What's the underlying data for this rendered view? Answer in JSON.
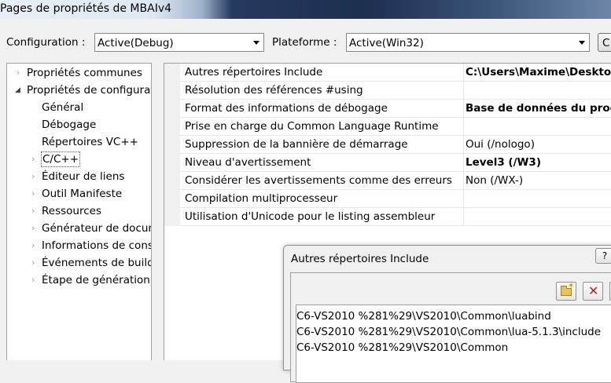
{
  "window": {
    "title": "Pages de propriétés de MBAIv4"
  },
  "config_bar": {
    "configuration_label": "Configuration :",
    "configuration_value": "Active(Debug)",
    "platform_label": "Plateforme :",
    "platform_value": "Active(Win32)",
    "button_label": "C"
  },
  "tree": {
    "items": [
      {
        "label": "Propriétés communes",
        "level": 0,
        "expander": "collapsed"
      },
      {
        "label": "Propriétés de configurat",
        "level": 0,
        "expander": "expanded"
      },
      {
        "label": "Général",
        "level": 1,
        "expander": "none"
      },
      {
        "label": "Débogage",
        "level": 1,
        "expander": "none"
      },
      {
        "label": "Répertoires VC++",
        "level": 1,
        "expander": "none"
      },
      {
        "label": "C/C++",
        "level": 1,
        "expander": "collapsed",
        "selected": true
      },
      {
        "label": "Éditeur de liens",
        "level": 1,
        "expander": "collapsed"
      },
      {
        "label": "Outil Manifeste",
        "level": 1,
        "expander": "collapsed"
      },
      {
        "label": "Ressources",
        "level": 1,
        "expander": "collapsed"
      },
      {
        "label": "Générateur de docum",
        "level": 1,
        "expander": "collapsed"
      },
      {
        "label": "Informations de cons",
        "level": 1,
        "expander": "collapsed"
      },
      {
        "label": "Événements de build",
        "level": 1,
        "expander": "collapsed"
      },
      {
        "label": "Étape de génération",
        "level": 1,
        "expander": "collapsed"
      }
    ]
  },
  "properties": [
    {
      "name": "Autres répertoires Include",
      "value": "C:\\Users\\Maxime\\Desktop",
      "bold": true
    },
    {
      "name": "Résolution des références #using",
      "value": "",
      "bold": false
    },
    {
      "name": "Format des informations de débogage",
      "value": "Base de données du progra",
      "bold": true
    },
    {
      "name": "Prise en charge du Common Language Runtime",
      "value": "",
      "bold": false
    },
    {
      "name": "Suppression de la bannière de démarrage",
      "value": "Oui (/nologo)",
      "bold": false
    },
    {
      "name": "Niveau d'avertissement",
      "value": "Level3 (/W3)",
      "bold": true
    },
    {
      "name": "Considérer les avertissements comme des erreurs",
      "value": "Non (/WX-)",
      "bold": false
    },
    {
      "name": "Compilation multiprocesseur",
      "value": "",
      "bold": false
    },
    {
      "name": "Utilisation d'Unicode pour le listing assembleur",
      "value": "",
      "bold": false
    }
  ],
  "dialog": {
    "title": "Autres répertoires Include",
    "help_label": "?",
    "tools": [
      "new-folder-icon",
      "delete-icon"
    ],
    "paths": [
      "C6-VS2010 %281%29\\VS2010\\Common\\luabind",
      "C6-VS2010 %281%29\\VS2010\\Common\\lua-5.1.3\\include",
      "C6-VS2010 %281%29\\VS2010\\Common"
    ]
  },
  "colors": {
    "accent": "#1e2f4f",
    "window_bg": "#f0f0f0"
  }
}
